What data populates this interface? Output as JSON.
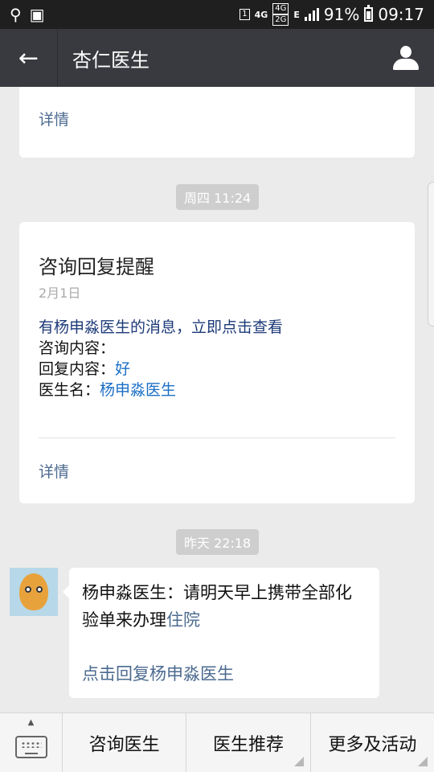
{
  "status_bar": {
    "notif_badge": "1",
    "net_4g": "4G",
    "net_4g_box": "4G",
    "net_2g_box": "2G",
    "net_e": "E",
    "battery": "91%",
    "time": "09:17"
  },
  "header": {
    "title": "杏仁医生"
  },
  "messages": {
    "prev_card_link": "详情",
    "time_1": "周四 11:24",
    "card": {
      "title": "咨询回复提醒",
      "date": "2月1日",
      "notice": "有杨申淼医生的消息，立即点击查看",
      "inquiry_label": "咨询内容：",
      "inquiry_value": "",
      "reply_label": "回复内容：",
      "reply_value": "好",
      "doctor_label": "医生名：",
      "doctor_value": "杨申淼医生",
      "link": "详情"
    },
    "time_2": "昨天 22:18",
    "bubble": {
      "text_prefix": "杨申淼医生：请明天早上携带全部化验单来办理",
      "text_link": "住院",
      "reply_link": "点击回复杨申淼医生"
    }
  },
  "bottom_menu": {
    "items": [
      "咨询医生",
      "医生推荐",
      "更多及活动"
    ]
  }
}
